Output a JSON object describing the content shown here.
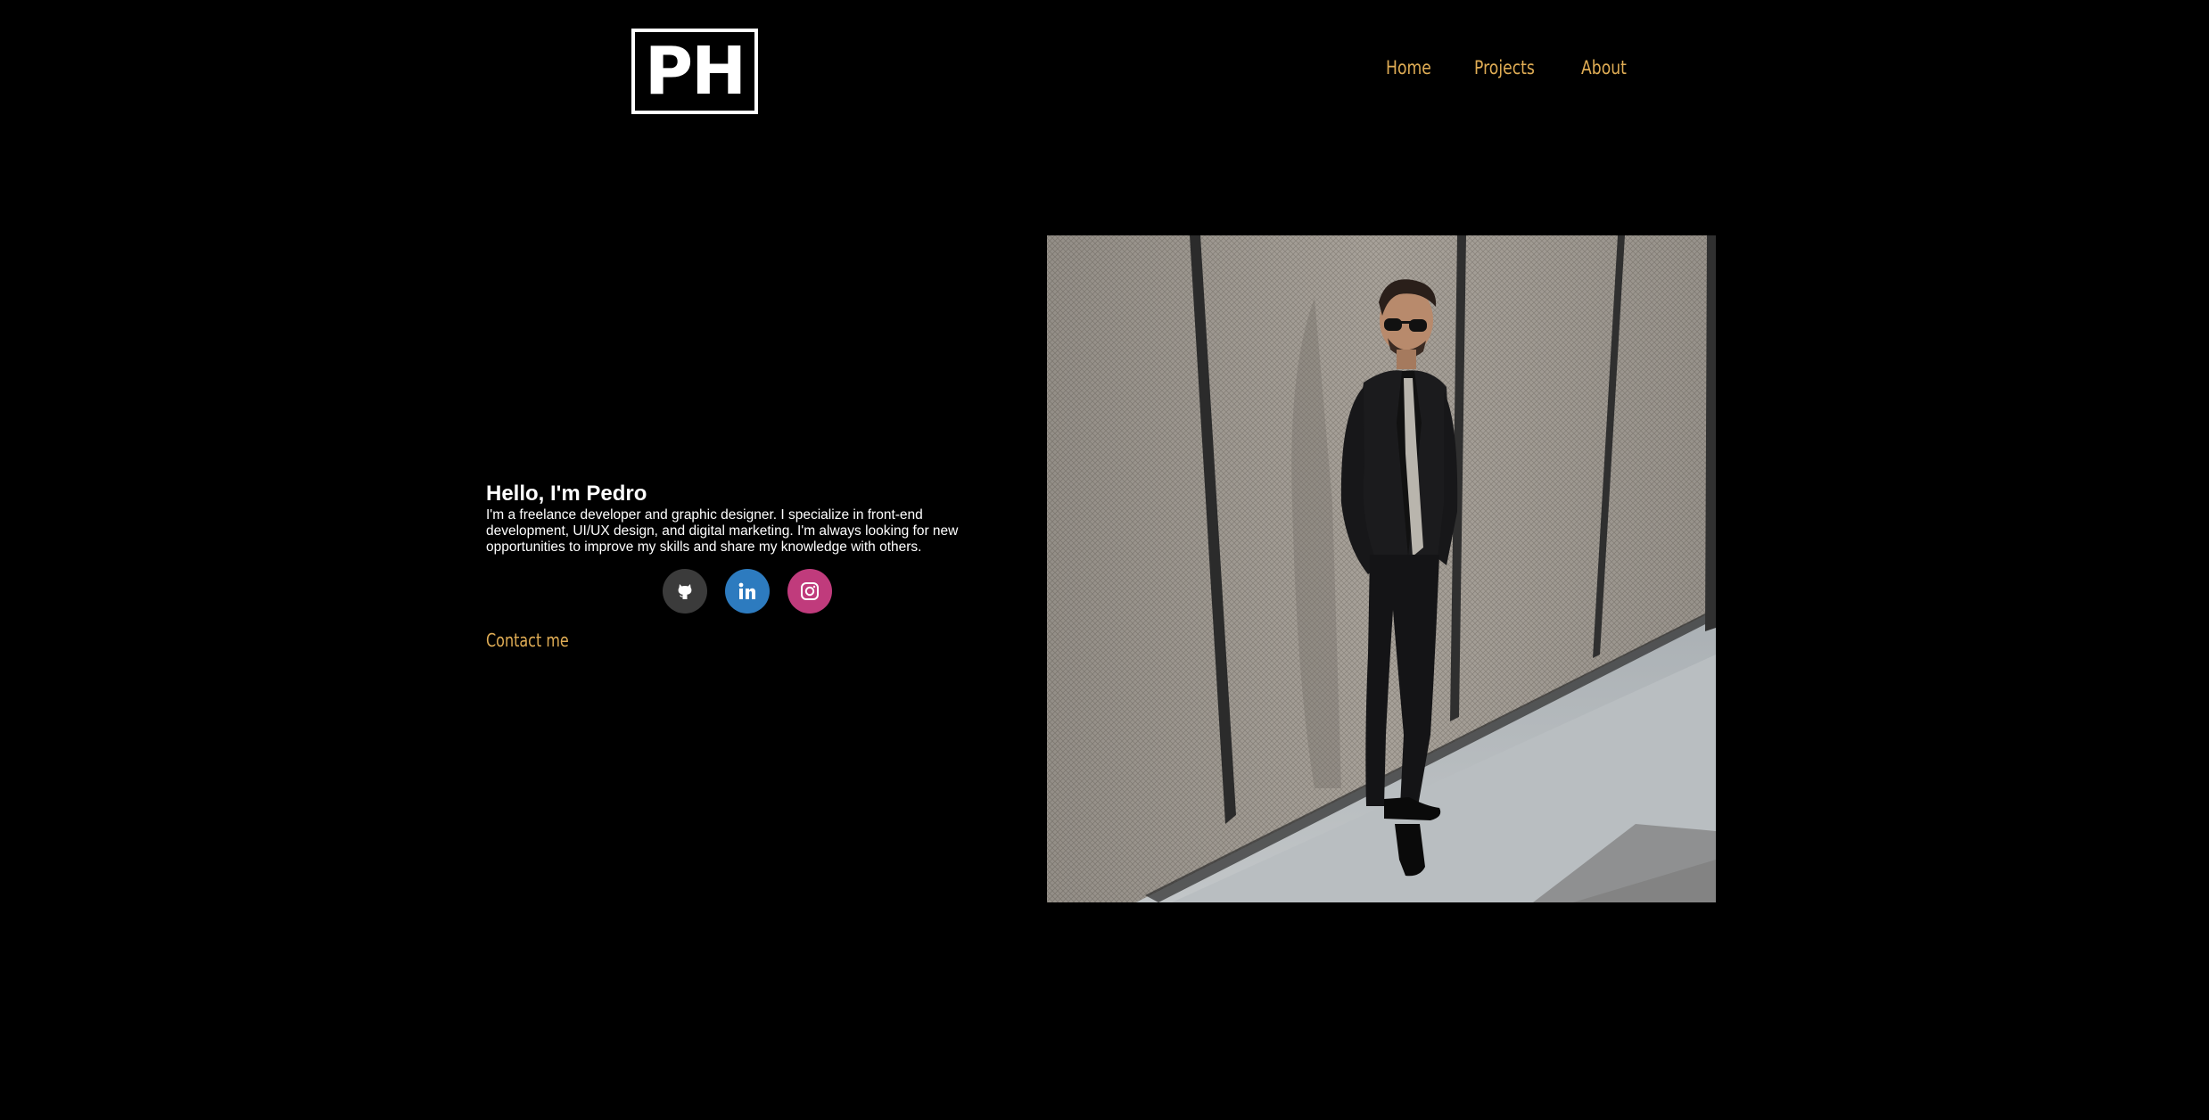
{
  "header": {
    "logo_text": "PH",
    "nav": [
      {
        "label": "Home"
      },
      {
        "label": "Projects"
      },
      {
        "label": "About"
      }
    ]
  },
  "hero": {
    "title": "Hello, I'm Pedro",
    "description": "I'm a freelance developer and graphic designer. I specialize in front-end development, UI/UX design, and digital marketing. I'm always looking for new opportunities to improve my skills and share my knowledge with others.",
    "contact_label": "Contact me",
    "socials": [
      {
        "name": "GitHub",
        "icon": "github-icon",
        "color": "#3b3b3b"
      },
      {
        "name": "LinkedIn",
        "icon": "linkedin-icon",
        "color": "#2d7bbf"
      },
      {
        "name": "Instagram",
        "icon": "instagram-icon",
        "color": "#c03b7c"
      }
    ]
  },
  "colors": {
    "background": "#000000",
    "accent": "#e0ad55",
    "text": "#ffffff"
  }
}
